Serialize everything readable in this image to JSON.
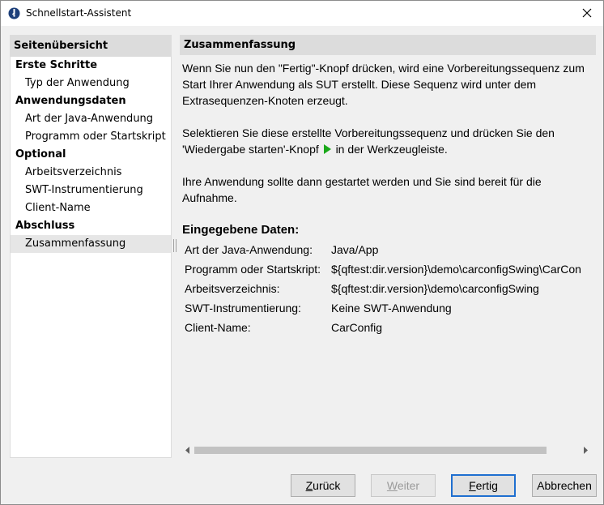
{
  "window": {
    "title": "Schnellstart-Assistent"
  },
  "sidebar": {
    "header": "Seitenübersicht",
    "sections": [
      {
        "label": "Erste Schritte",
        "items": [
          "Typ der Anwendung"
        ]
      },
      {
        "label": "Anwendungsdaten",
        "items": [
          "Art der Java-Anwendung",
          "Programm oder Startskript"
        ]
      },
      {
        "label": "Optional",
        "items": [
          "Arbeitsverzeichnis",
          "SWT-Instrumentierung",
          "Client-Name"
        ]
      },
      {
        "label": "Abschluss",
        "items": [
          "Zusammenfassung"
        ]
      }
    ],
    "selected_item": "Zusammenfassung"
  },
  "main": {
    "title": "Zusammenfassung",
    "paragraph1": "Wenn Sie nun den \"Fertig\"-Knopf drücken, wird eine Vorbereitungssequenz zum Start Ihrer Anwendung als SUT erstellt. Diese Sequenz wird unter dem Extrasequenzen-Knoten erzeugt.",
    "paragraph2_before_icon": "Selektieren Sie diese erstellte Vorbereitungssequenz und drücken Sie den 'Wiedergabe starten'-Knopf",
    "paragraph2_after_icon": "in der Werkzeugleiste.",
    "paragraph3": "Ihre Anwendung sollte dann gestartet werden und Sie sind bereit für die Aufnahme.",
    "data_title": "Eingegebene Daten:",
    "data_rows": [
      {
        "key": "Art der Java-Anwendung:",
        "value": "Java/App"
      },
      {
        "key": "Programm oder Startskript:",
        "value": "${qftest:dir.version}\\demo\\carconfigSwing\\CarCon"
      },
      {
        "key": "Arbeitsverzeichnis:",
        "value": "${qftest:dir.version}\\demo\\carconfigSwing"
      },
      {
        "key": "SWT-Instrumentierung:",
        "value": "Keine SWT-Anwendung"
      },
      {
        "key": "Client-Name:",
        "value": "CarConfig"
      }
    ]
  },
  "buttons": {
    "back": {
      "label": "Zurück",
      "mnemonic_char": "Z",
      "rest": "urück"
    },
    "next": {
      "label": "Weiter",
      "mnemonic_char": "W",
      "rest": "eiter"
    },
    "finish": {
      "label": "Fertig",
      "mnemonic_char": "F",
      "rest": "ertig"
    },
    "cancel": {
      "label": "Abbrechen"
    }
  },
  "colors": {
    "play_icon": "#1aa81a",
    "default_button_border": "#1f6fd0",
    "app_icon": "#1c3f7a"
  },
  "icons": {
    "app": "qftest-logo-icon",
    "close": "close-icon",
    "play": "play-icon"
  }
}
